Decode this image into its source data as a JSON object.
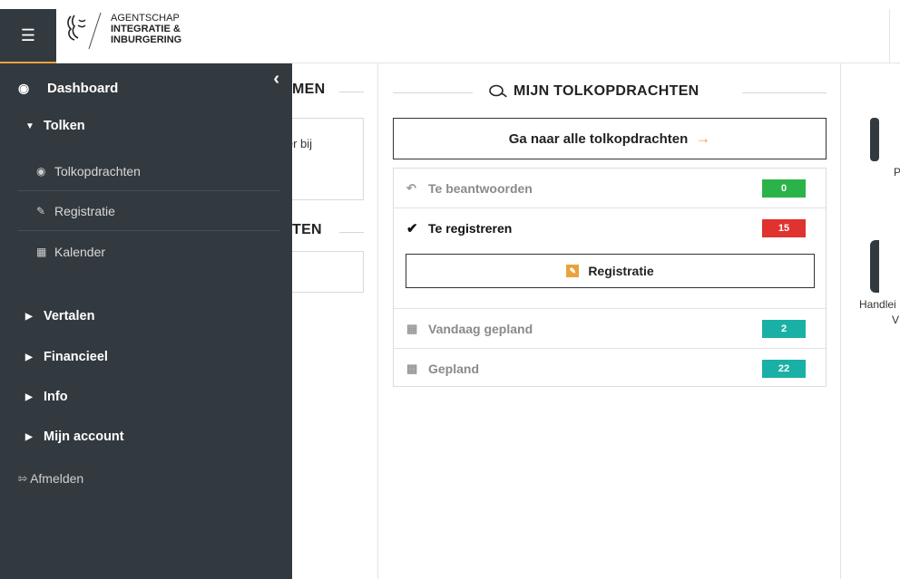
{
  "header": {
    "agency_line1": "AGENTSCHAP",
    "agency_line2": "INTEGRATIE &",
    "agency_line3": "INBURGERING"
  },
  "sidebar": {
    "dashboard_label": "Dashboard",
    "groups": [
      {
        "label": "Tolken",
        "expanded": true
      },
      {
        "label": "Vertalen",
        "expanded": false
      },
      {
        "label": "Financieel",
        "expanded": false
      },
      {
        "label": "Info",
        "expanded": false
      },
      {
        "label": "Mijn account",
        "expanded": false
      }
    ],
    "tolken_items": [
      {
        "label": "Tolkopdrachten",
        "icon": "comments-icon"
      },
      {
        "label": "Registratie",
        "icon": "edit-icon"
      },
      {
        "label": "Kalender",
        "icon": "calendar-icon"
      }
    ],
    "logout_label": "Afmelden"
  },
  "left_column": {
    "section1_title_partial": "MEN",
    "card1_text_partial": "ler bij",
    "section2_title_partial": "TEN"
  },
  "tolkopdrachten": {
    "section_title": "MIJN TOLKOPDRACHTEN",
    "goto_label": "Ga naar alle tolkopdrachten",
    "rows": [
      {
        "label": "Te beantwoorden",
        "count": "0",
        "color": "#2bb34a"
      },
      {
        "label": "Te registreren",
        "count": "15",
        "color": "#e0322f"
      },
      {
        "label": "Vandaag gepland",
        "count": "2",
        "color": "#1ab0a5"
      },
      {
        "label": "Gepland",
        "count": "22",
        "color": "#1ab0a5"
      }
    ],
    "registratie_button": "Registratie"
  },
  "right_column": {
    "tile1_text_partial": "P",
    "tile2_text_line1_partial": "Handlei",
    "tile2_text_line2_partial": "V"
  },
  "colors": {
    "sidebar_bg": "#333a3f",
    "accent": "#e8a33c"
  }
}
